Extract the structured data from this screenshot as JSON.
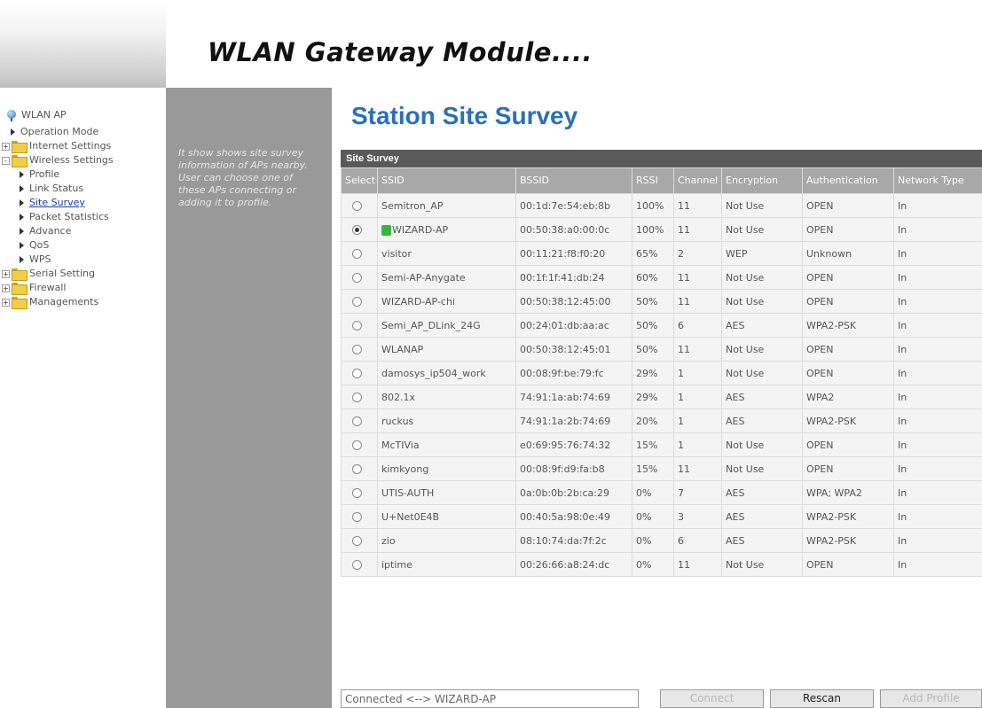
{
  "header": {
    "title": "WLAN Gateway Module...."
  },
  "tree": {
    "root": "WLAN AP",
    "items": [
      {
        "label": "Operation Mode",
        "kind": "page"
      },
      {
        "label": "Internet Settings",
        "kind": "folder",
        "expander": "+"
      },
      {
        "label": "Wireless Settings",
        "kind": "folder",
        "expander": "-"
      },
      {
        "label": "Profile",
        "kind": "page"
      },
      {
        "label": "Link Status",
        "kind": "page"
      },
      {
        "label": "Site Survey",
        "kind": "page",
        "selected": true
      },
      {
        "label": "Packet Statistics",
        "kind": "page"
      },
      {
        "label": "Advance",
        "kind": "page"
      },
      {
        "label": "QoS",
        "kind": "page"
      },
      {
        "label": "WPS",
        "kind": "page"
      },
      {
        "label": "Serial Setting",
        "kind": "folder",
        "expander": "+"
      },
      {
        "label": "Firewall",
        "kind": "folder",
        "expander": "+"
      },
      {
        "label": "Managements",
        "kind": "folder",
        "expander": "+"
      }
    ]
  },
  "help": {
    "text": "It show shows site survey information of APs nearby. User can choose one of these APs connecting or adding it to profile."
  },
  "main": {
    "title": "Station Site Survey",
    "caption": "Site Survey",
    "columns": [
      "Select",
      "SSID",
      "BSSID",
      "RSSI",
      "Channel",
      "Encryption",
      "Authentication",
      "Network Type"
    ],
    "rows": [
      {
        "selected": false,
        "ssid": "Semitron_AP",
        "bssid": "00:1d:7e:54:eb:8b",
        "rssi": "100%",
        "channel": "11",
        "encryption": "Not Use",
        "auth": "OPEN",
        "type": "In"
      },
      {
        "selected": true,
        "ssid": "WIZARD-AP",
        "bssid": "00:50:38:a0:00:0c",
        "rssi": "100%",
        "channel": "11",
        "encryption": "Not Use",
        "auth": "OPEN",
        "type": "In",
        "connected": true
      },
      {
        "selected": false,
        "ssid": "visitor",
        "bssid": "00:11:21:f8:f0:20",
        "rssi": "65%",
        "channel": "2",
        "encryption": "WEP",
        "auth": "Unknown",
        "type": "In"
      },
      {
        "selected": false,
        "ssid": "Semi-AP-Anygate",
        "bssid": "00:1f:1f:41:db:24",
        "rssi": "60%",
        "channel": "11",
        "encryption": "Not Use",
        "auth": "OPEN",
        "type": "In"
      },
      {
        "selected": false,
        "ssid": "WIZARD-AP-chi",
        "bssid": "00:50:38:12:45:00",
        "rssi": "50%",
        "channel": "11",
        "encryption": "Not Use",
        "auth": "OPEN",
        "type": "In"
      },
      {
        "selected": false,
        "ssid": "Semi_AP_DLink_24G",
        "bssid": "00:24:01:db:aa:ac",
        "rssi": "50%",
        "channel": "6",
        "encryption": "AES",
        "auth": "WPA2-PSK",
        "type": "In"
      },
      {
        "selected": false,
        "ssid": "WLANAP",
        "bssid": "00:50:38:12:45:01",
        "rssi": "50%",
        "channel": "11",
        "encryption": "Not Use",
        "auth": "OPEN",
        "type": "In"
      },
      {
        "selected": false,
        "ssid": "damosys_ip504_work",
        "bssid": "00:08:9f:be:79:fc",
        "rssi": "29%",
        "channel": "1",
        "encryption": "Not Use",
        "auth": "OPEN",
        "type": "In"
      },
      {
        "selected": false,
        "ssid": "802.1x",
        "bssid": "74:91:1a:ab:74:69",
        "rssi": "29%",
        "channel": "1",
        "encryption": "AES",
        "auth": "WPA2",
        "type": "In"
      },
      {
        "selected": false,
        "ssid": "ruckus",
        "bssid": "74:91:1a:2b:74:69",
        "rssi": "20%",
        "channel": "1",
        "encryption": "AES",
        "auth": "WPA2-PSK",
        "type": "In"
      },
      {
        "selected": false,
        "ssid": "McTIVia",
        "bssid": "e0:69:95:76:74:32",
        "rssi": "15%",
        "channel": "1",
        "encryption": "Not Use",
        "auth": "OPEN",
        "type": "In"
      },
      {
        "selected": false,
        "ssid": "kimkyong",
        "bssid": "00:08:9f:d9:fa:b8",
        "rssi": "15%",
        "channel": "11",
        "encryption": "Not Use",
        "auth": "OPEN",
        "type": "In"
      },
      {
        "selected": false,
        "ssid": "UTIS-AUTH",
        "bssid": "0a:0b:0b:2b:ca:29",
        "rssi": "0%",
        "channel": "7",
        "encryption": "AES",
        "auth": "WPA; WPA2",
        "type": "In"
      },
      {
        "selected": false,
        "ssid": "U+Net0E4B",
        "bssid": "00:40:5a:98:0e:49",
        "rssi": "0%",
        "channel": "3",
        "encryption": "AES",
        "auth": "WPA2-PSK",
        "type": "In"
      },
      {
        "selected": false,
        "ssid": "zio",
        "bssid": "08:10:74:da:7f:2c",
        "rssi": "0%",
        "channel": "6",
        "encryption": "AES",
        "auth": "WPA2-PSK",
        "type": "In"
      },
      {
        "selected": false,
        "ssid": "iptime",
        "bssid": "00:26:66:a8:24:dc",
        "rssi": "0%",
        "channel": "11",
        "encryption": "Not Use",
        "auth": "OPEN",
        "type": "In"
      }
    ],
    "connection_status": "Connected <--> WIZARD-AP",
    "buttons": {
      "connect": "Connect",
      "rescan": "Rescan",
      "add_profile": "Add Profile"
    }
  }
}
